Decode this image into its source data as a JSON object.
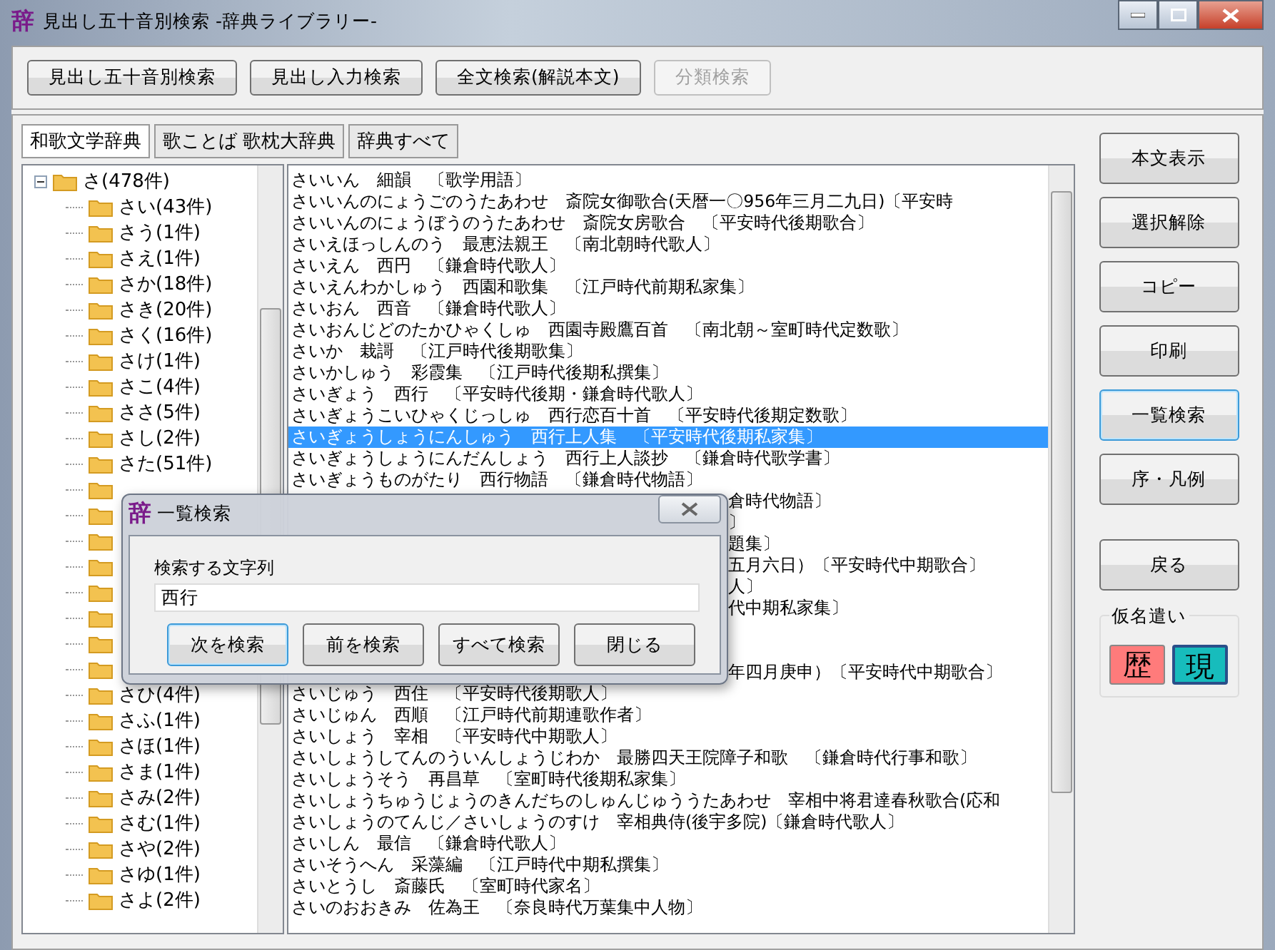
{
  "window": {
    "app_icon": "辞",
    "title": "見出し五十音別検索 -辞典ライブラリー-"
  },
  "toolbar": [
    {
      "label": "見出し五十音別検索",
      "disabled": false
    },
    {
      "label": "見出し入力検索",
      "disabled": false
    },
    {
      "label": "全文検索(解説本文)",
      "disabled": false
    },
    {
      "label": "分類検索",
      "disabled": true
    }
  ],
  "tabs": [
    {
      "label": "和歌文学辞典",
      "selected": true
    },
    {
      "label": "歌ことば 歌枕大辞典",
      "selected": false
    },
    {
      "label": "辞典すべて",
      "selected": false
    }
  ],
  "tree": [
    {
      "label": "さ(478件)",
      "expanded": true,
      "children": [
        {
          "kind": "folder",
          "label": "さい(43件)"
        },
        {
          "kind": "folder",
          "label": "さう(1件)"
        },
        {
          "kind": "folder",
          "label": "さえ(1件)"
        },
        {
          "kind": "folder",
          "label": "さか(18件)"
        },
        {
          "kind": "folder",
          "label": "さき(20件)"
        },
        {
          "kind": "folder",
          "label": "さく(16件)"
        },
        {
          "kind": "folder",
          "label": "さけ(1件)"
        },
        {
          "kind": "folder",
          "label": "さこ(4件)"
        },
        {
          "kind": "folder",
          "label": "ささ(5件)"
        },
        {
          "kind": "folder",
          "label": "さし(2件)"
        },
        {
          "kind": "folder",
          "label": "さた(51件)"
        },
        {
          "kind": "covered"
        },
        {
          "kind": "covered"
        },
        {
          "kind": "covered"
        },
        {
          "kind": "covered"
        },
        {
          "kind": "covered"
        },
        {
          "kind": "covered"
        },
        {
          "kind": "covered"
        },
        {
          "kind": "covered"
        },
        {
          "kind": "folder",
          "label": "さひ(4件)"
        },
        {
          "kind": "folder",
          "label": "さふ(1件)"
        },
        {
          "kind": "folder",
          "label": "さほ(1件)"
        },
        {
          "kind": "folder",
          "label": "さま(1件)"
        },
        {
          "kind": "folder",
          "label": "さみ(2件)"
        },
        {
          "kind": "folder",
          "label": "さむ(1件)"
        },
        {
          "kind": "folder",
          "label": "さや(2件)"
        },
        {
          "kind": "folder",
          "label": "さゆ(1件)"
        },
        {
          "kind": "folder",
          "label": "さよ(2件)"
        }
      ]
    }
  ],
  "list": [
    {
      "kind": "entry",
      "text": "さいいん　細韻　〔歌学用語〕",
      "selected": false
    },
    {
      "kind": "entry",
      "text": "さいいんのにょうごのうたあわせ　斎院女御歌合(天暦一〇956年三月二九日)〔平安時",
      "selected": false
    },
    {
      "kind": "entry",
      "text": "さいいんのにょうぼうのうたあわせ　斎院女房歌合　〔平安時代後期歌合〕",
      "selected": false
    },
    {
      "kind": "entry",
      "text": "さいえほっしんのう　最恵法親王　〔南北朝時代歌人〕",
      "selected": false
    },
    {
      "kind": "entry",
      "text": "さいえん　西円　〔鎌倉時代歌人〕",
      "selected": false
    },
    {
      "kind": "entry",
      "text": "さいえんわかしゅう　西園和歌集　〔江戸時代前期私家集〕",
      "selected": false
    },
    {
      "kind": "entry",
      "text": "さいおん　西音　〔鎌倉時代歌人〕",
      "selected": false
    },
    {
      "kind": "entry",
      "text": "さいおんじどのたかひゃくしゅ　西園寺殿鷹百首　〔南北朝～室町時代定数歌〕",
      "selected": false
    },
    {
      "kind": "entry",
      "text": "さいか　栽謌　〔江戸時代後期歌集〕",
      "selected": false
    },
    {
      "kind": "entry",
      "text": "さいかしゅう　彩霞集　〔江戸時代後期私撰集〕",
      "selected": false
    },
    {
      "kind": "entry",
      "text": "さいぎょう　西行　〔平安時代後期・鎌倉時代歌人〕",
      "selected": false
    },
    {
      "kind": "entry",
      "text": "さいぎょうこいひゃくじっしゅ　西行恋百十首　〔平安時代後期定数歌〕",
      "selected": false
    },
    {
      "kind": "entry",
      "text": "さいぎょうしょうにんしゅう　西行上人集　〔平安時代後期私家集〕",
      "selected": true
    },
    {
      "kind": "entry",
      "text": "さいぎょうしょうにんだんしょう　西行上人談抄　〔鎌倉時代歌学書〕",
      "selected": false
    },
    {
      "kind": "entry",
      "text": "さいぎょうものがたり　西行物語　〔鎌倉時代物語〕",
      "selected": false
    },
    {
      "kind": "partial",
      "text": "倉時代物語〕",
      "selected": false
    },
    {
      "kind": "partial",
      "text": "〕",
      "selected": false
    },
    {
      "kind": "partial",
      "text": "題集〕",
      "selected": false
    },
    {
      "kind": "partial",
      "text": "五月六日）〔平安時代中期歌合〕",
      "selected": false
    },
    {
      "kind": "partial",
      "text": "人〕",
      "selected": false
    },
    {
      "kind": "partial",
      "text": "代中期私家集〕",
      "selected": false
    },
    {
      "kind": "covered",
      "selected": false
    },
    {
      "kind": "covered",
      "selected": false
    },
    {
      "kind": "partial",
      "text": "年四月庚申）〔平安時代中期歌合〕",
      "selected": false
    },
    {
      "kind": "entry",
      "text": "さいじゅう　西住　〔平安時代後期歌人〕",
      "selected": false
    },
    {
      "kind": "entry",
      "text": "さいじゅん　西順　〔江戸時代前期連歌作者〕",
      "selected": false
    },
    {
      "kind": "entry",
      "text": "さいしょう　宰相　〔平安時代中期歌人〕",
      "selected": false
    },
    {
      "kind": "entry",
      "text": "さいしょうしてんのういんしょうじわか　最勝四天王院障子和歌　〔鎌倉時代行事和歌〕",
      "selected": false
    },
    {
      "kind": "entry",
      "text": "さいしょうそう　再昌草　〔室町時代後期私家集〕",
      "selected": false
    },
    {
      "kind": "entry",
      "text": "さいしょうちゅうじょうのきんだちのしゅんじゅううたあわせ　宰相中将君達春秋歌合(応和",
      "selected": false
    },
    {
      "kind": "entry",
      "text": "さいしょうのてんじ／さいしょうのすけ　宰相典侍(後宇多院)〔鎌倉時代歌人〕",
      "selected": false
    },
    {
      "kind": "entry",
      "text": "さいしん　最信　〔鎌倉時代歌人〕",
      "selected": false
    },
    {
      "kind": "entry",
      "text": "さいそうへん　采藻編　〔江戸時代中期私撰集〕",
      "selected": false
    },
    {
      "kind": "entry",
      "text": "さいとうし　斎藤氏　〔室町時代家名〕",
      "selected": false
    },
    {
      "kind": "entry",
      "text": "さいのおおきみ　佐為王　〔奈良時代万葉集中人物〕",
      "selected": false
    }
  ],
  "side_buttons": [
    {
      "label": "本文表示",
      "focused": false
    },
    {
      "label": "選択解除",
      "focused": false
    },
    {
      "label": "コピー",
      "focused": false
    },
    {
      "label": "印刷",
      "focused": false
    },
    {
      "label": "一覧検索",
      "focused": true
    },
    {
      "label": "序・凡例",
      "focused": false
    },
    {
      "label": "戻る",
      "focused": false
    }
  ],
  "kana_group": {
    "title": "仮名遣い",
    "options": [
      {
        "label": "歴",
        "color": "#ff7b7b",
        "selected": false
      },
      {
        "label": "現",
        "color": "#17bcbc",
        "selected": true
      }
    ]
  },
  "dialog": {
    "app_icon": "辞",
    "title": "一覧検索",
    "field_label": "検索する文字列",
    "value": "西行",
    "buttons": [
      {
        "label": "次を検索",
        "focused": true
      },
      {
        "label": "前を検索",
        "focused": false
      },
      {
        "label": "すべて検索",
        "focused": false
      },
      {
        "label": "閉じる",
        "focused": false
      }
    ]
  }
}
